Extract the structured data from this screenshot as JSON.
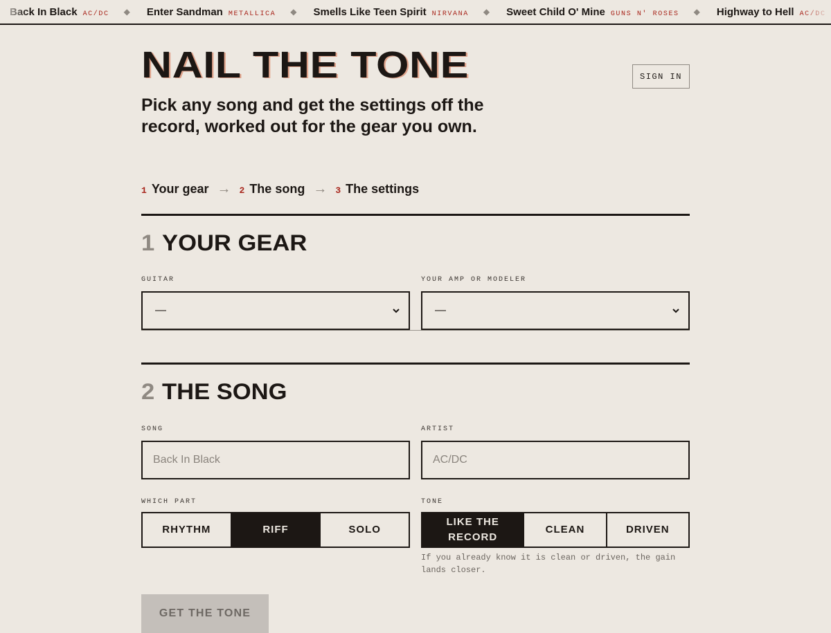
{
  "ticker": [
    {
      "song": "Back In Black",
      "artist": "AC/DC"
    },
    {
      "song": "Enter Sandman",
      "artist": "METALLICA"
    },
    {
      "song": "Smells Like Teen Spirit",
      "artist": "NIRVANA"
    },
    {
      "song": "Sweet Child O' Mine",
      "artist": "GUNS N' ROSES"
    },
    {
      "song": "Highway to Hell",
      "artist": "AC/DC"
    }
  ],
  "header": {
    "title": "NAIL THE TONE",
    "sign_in": "SIGN IN",
    "subtitle": "Pick any song and get the settings off the record, worked out for the gear you own."
  },
  "steps": [
    {
      "num": "1",
      "label": "Your gear"
    },
    {
      "num": "2",
      "label": "The song"
    },
    {
      "num": "3",
      "label": "The settings"
    }
  ],
  "gear": {
    "num": "1",
    "heading": "YOUR GEAR",
    "guitar_label": "GUITAR",
    "guitar_value": "—",
    "amp_label": "YOUR AMP OR MODELER",
    "amp_value": "—"
  },
  "song": {
    "num": "2",
    "heading": "THE SONG",
    "song_label": "SONG",
    "song_placeholder": "Back In Black",
    "artist_label": "ARTIST",
    "artist_placeholder": "AC/DC",
    "part_label": "WHICH PART",
    "parts": [
      "RHYTHM",
      "RIFF",
      "SOLO"
    ],
    "selected_part": "RIFF",
    "tone_label": "TONE",
    "tones": [
      "LIKE THE RECORD",
      "CLEAN",
      "DRIVEN"
    ],
    "selected_tone": "LIKE THE RECORD",
    "tone_hint": "If you already know it is clean or driven, the gain lands closer."
  },
  "cta": {
    "label": "GET THE TONE"
  },
  "colors": {
    "ink": "#1c1714",
    "paper": "#ede8e1",
    "accent": "#a8251b",
    "muted": "#8f8982"
  }
}
